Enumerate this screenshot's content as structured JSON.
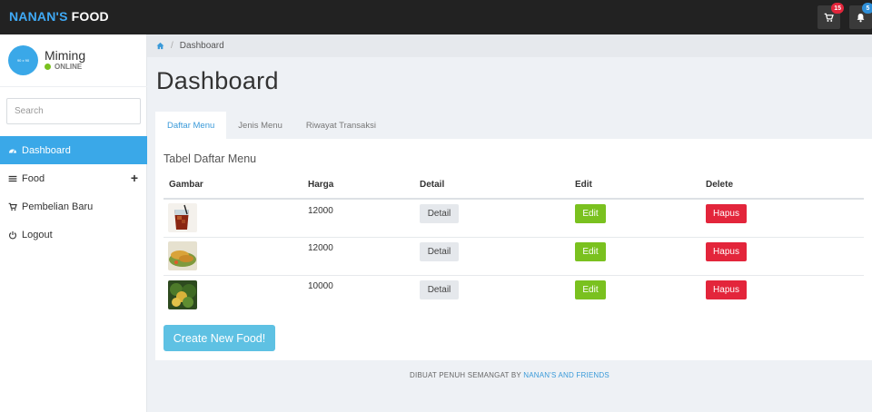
{
  "brand": {
    "part1": "NANAN'S",
    "part2": "FOOD"
  },
  "navbar": {
    "cart_count": "15",
    "notification_count": "5"
  },
  "user": {
    "avatar_text": "90 x 90",
    "name": "Miming",
    "status": "ONLINE"
  },
  "search": {
    "placeholder": "Search"
  },
  "sidebar": {
    "items": [
      {
        "label": "Dashboard",
        "icon": "dashboard-icon"
      },
      {
        "label": "Food",
        "icon": "bars-icon"
      },
      {
        "label": "Pembelian Baru",
        "icon": "cart-icon"
      },
      {
        "label": "Logout",
        "icon": "power-icon"
      }
    ],
    "food_expand": "+"
  },
  "breadcrumb": {
    "separator": "/",
    "current": "Dashboard"
  },
  "page": {
    "title": "Dashboard"
  },
  "tabs": [
    {
      "label": "Daftar Menu"
    },
    {
      "label": "Jenis Menu"
    },
    {
      "label": "Riwayat Transaksi"
    }
  ],
  "table": {
    "title": "Tabel Daftar Menu",
    "headers": {
      "gambar": "Gambar",
      "harga": "Harga",
      "detail": "Detail",
      "edit": "Edit",
      "delete": "Delete"
    },
    "rows": [
      {
        "image": "iced-drink-image",
        "price": "12000",
        "detail": "Detail",
        "edit": "Edit",
        "delete": "Hapus"
      },
      {
        "image": "fried-food-image",
        "price": "12000",
        "detail": "Detail",
        "edit": "Edit",
        "delete": "Hapus"
      },
      {
        "image": "salad-image",
        "price": "10000",
        "detail": "Detail",
        "edit": "Edit",
        "delete": "Hapus"
      }
    ],
    "create_label": "Create New Food!"
  },
  "footer": {
    "text": "DIBUAT PENUH SEMANGAT BY",
    "link": "NANAN'S AND FRIENDS"
  },
  "colors": {
    "navbar": "#222222",
    "accent": "#3aa8e8",
    "edit": "#7ac11f",
    "delete": "#e3253b",
    "create": "#5ec1e3"
  }
}
